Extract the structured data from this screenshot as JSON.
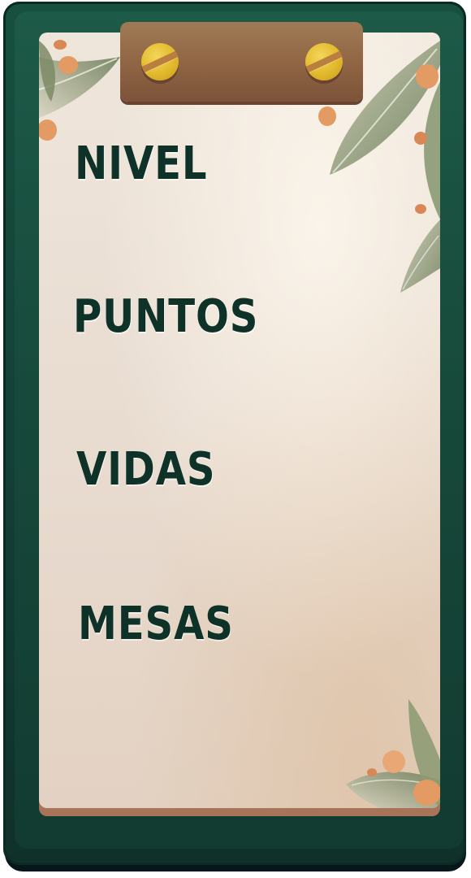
{
  "scoreboard": {
    "stats": [
      {
        "label": "NIVEL"
      },
      {
        "label": "PUNTOS"
      },
      {
        "label": "VIDAS"
      },
      {
        "label": "MESAS"
      }
    ]
  },
  "icons": {
    "clip_screws": [
      "screw-icon",
      "screw-icon"
    ],
    "decorations": [
      "leaf-icon",
      "coffee-bean-icon"
    ]
  },
  "colors": {
    "board": "#174a3b",
    "paper": "#ece2d7",
    "text": "#0e3228",
    "clip": "#8d6242",
    "screw": "#e2b92c",
    "leaf": "#8e9b7a",
    "bean": "#e39a63"
  }
}
